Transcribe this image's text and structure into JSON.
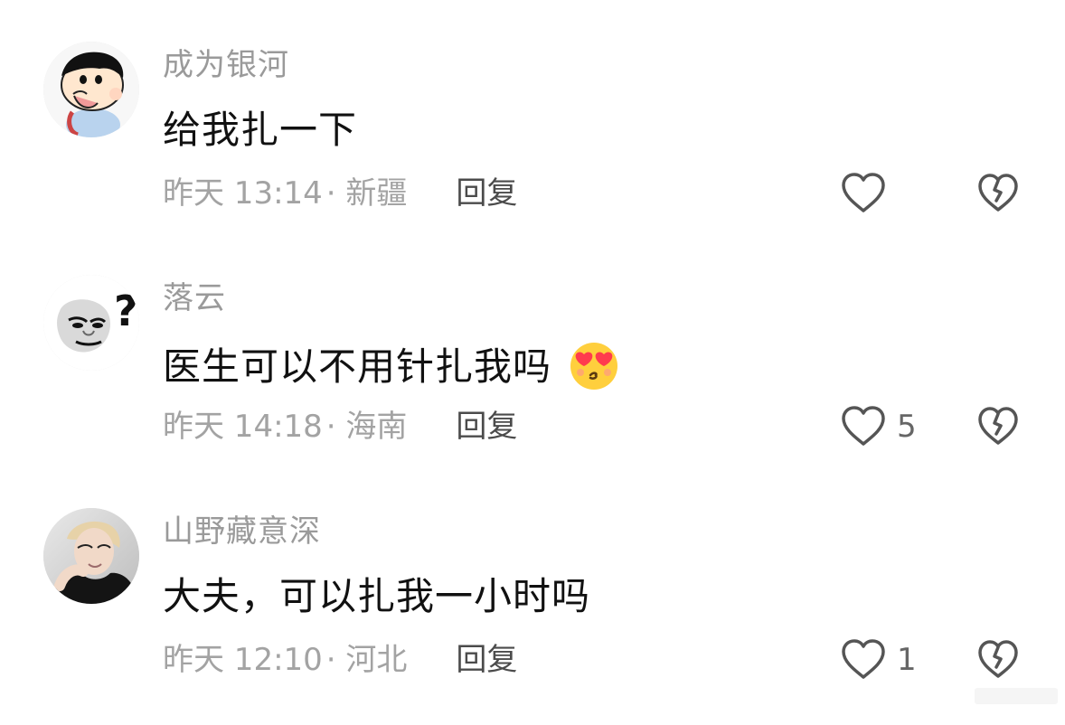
{
  "comments": [
    {
      "username": "成为银河",
      "text": "给我扎一下",
      "time": "昨天 13:14",
      "location": "· 新疆",
      "reply_label": "回复",
      "like_count": ""
    },
    {
      "username": "落云",
      "text": "医生可以不用针扎我吗",
      "time": "昨天 14:18",
      "location": "· 海南",
      "reply_label": "回复",
      "like_count": "5"
    },
    {
      "username": "山野藏意深",
      "text": "大夫，可以扎我一小时吗",
      "time": "昨天 12:10",
      "location": "· 河北",
      "reply_label": "回复",
      "like_count": "1"
    }
  ],
  "icons": {
    "like": "heart-outline-icon",
    "dislike": "broken-heart-icon",
    "emoji": "heart-eyes-kiss-emoji-icon"
  },
  "colors": {
    "username": "#9a9a9a",
    "meta": "#a3a3a3",
    "reply": "#4b4b4b",
    "icon": "#555555"
  }
}
